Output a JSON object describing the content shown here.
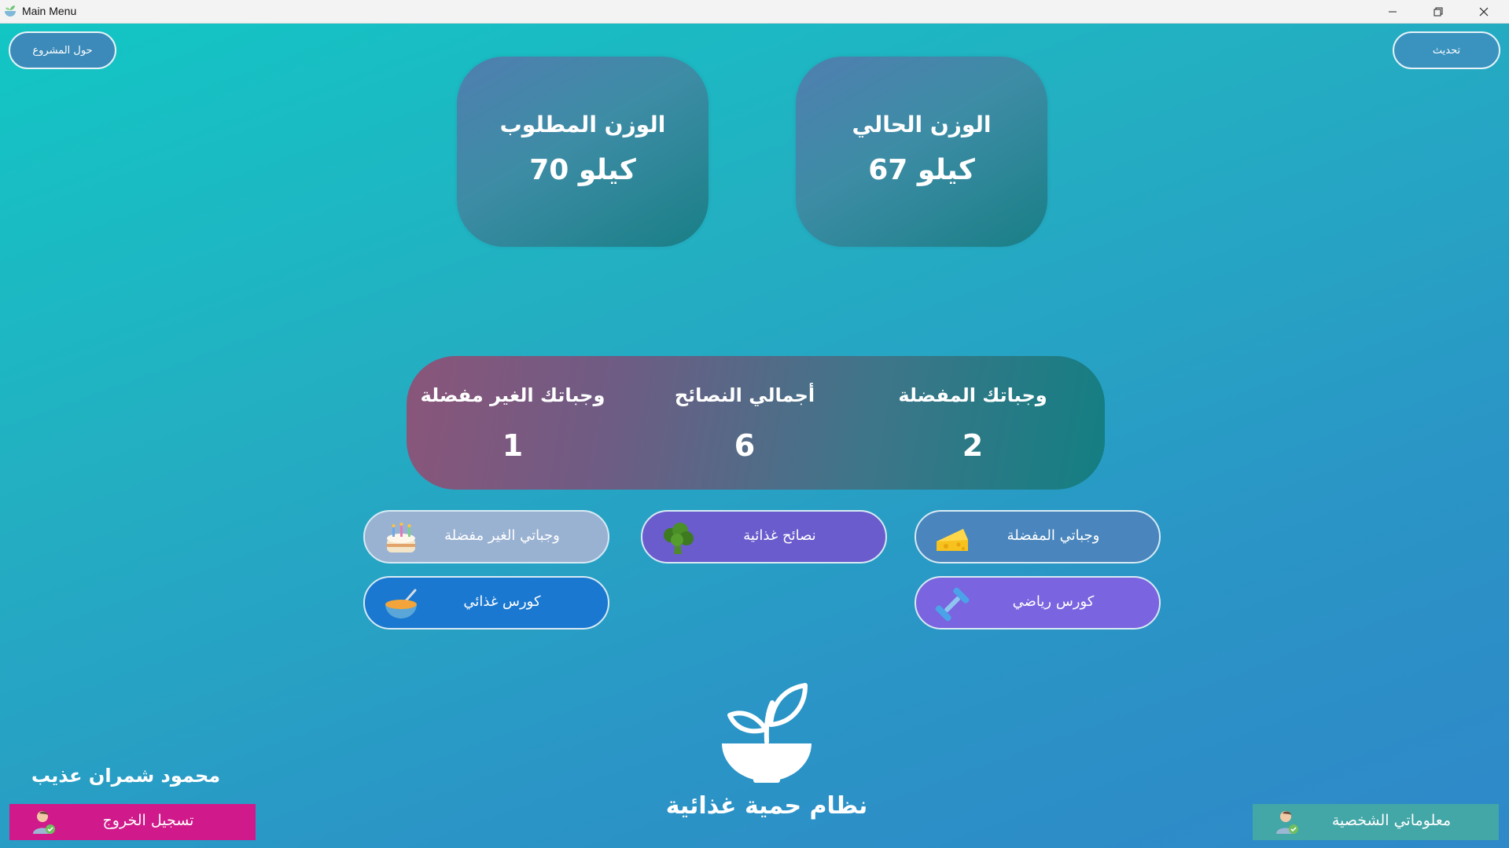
{
  "window": {
    "title": "Main Menu",
    "icon": "app-bowl-icon",
    "controls": [
      "minimize-icon",
      "restore-icon",
      "close-icon"
    ]
  },
  "top_buttons": {
    "about": "حول المشروع",
    "refresh": "تحديث"
  },
  "weights": {
    "target": {
      "label": "الوزن المطلوب",
      "value": "70 كيلو"
    },
    "current": {
      "label": "الوزن الحالي",
      "value": "67 كيلو"
    }
  },
  "stats": {
    "unfavorite_meals": {
      "label": "وجباتك الغير مفضلة",
      "value": "1"
    },
    "total_tips": {
      "label": "أجمالي النصائح",
      "value": "6"
    },
    "favorite_meals": {
      "label": "وجباتك المفضلة",
      "value": "2"
    }
  },
  "menu": {
    "unfavorite_meals": {
      "label": "وجباتي الغير مفضلة",
      "icon": "cake-icon"
    },
    "nutrition_tips": {
      "label": "نصائح غذائية",
      "icon": "broccoli-icon"
    },
    "favorite_meals": {
      "label": "وجباتي المفضلة",
      "icon": "cheese-icon"
    },
    "diet_course": {
      "label": "كورس غذائي",
      "icon": "bowl-icon"
    },
    "sport_course": {
      "label": "كورس رياضي",
      "icon": "dumbbell-icon"
    }
  },
  "app_name": "نظام حمية غذائية",
  "user": {
    "name": "محمود شمران عذيب",
    "logout": "تسجيل الخروج",
    "profile": "معلوماتي الشخصية"
  },
  "colors": {
    "gradient_start": "#12c6c4",
    "gradient_end": "#2f88c8",
    "logout": "#d0198a",
    "profile": "#43a6a7"
  }
}
